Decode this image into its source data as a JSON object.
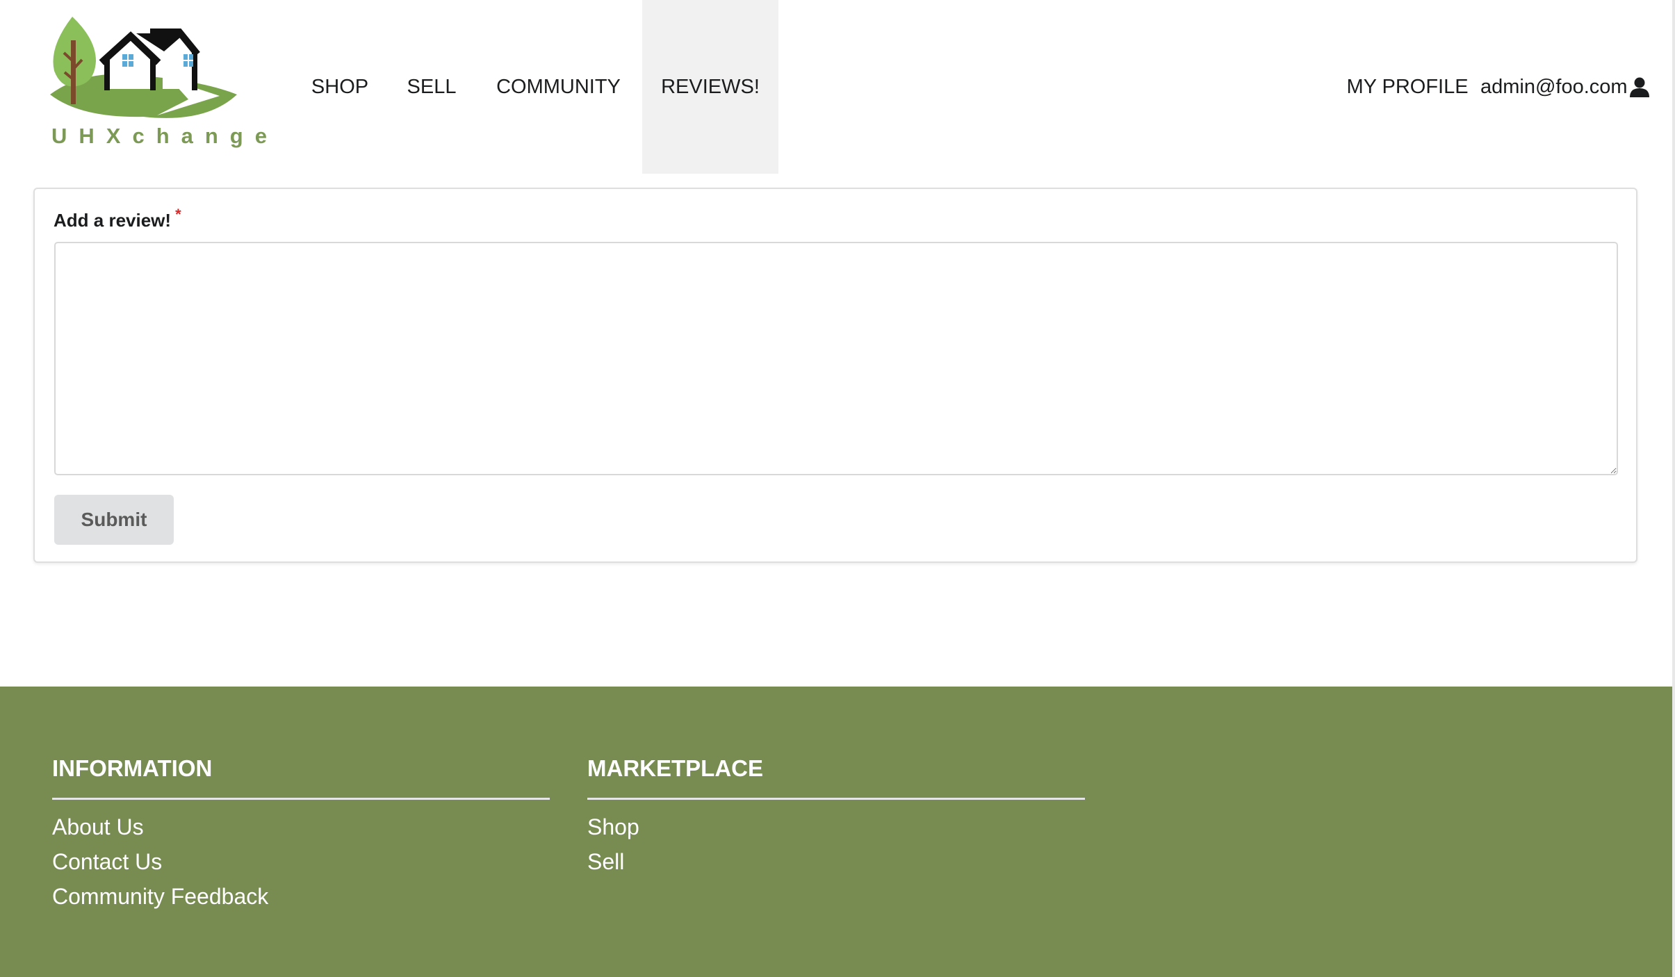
{
  "brand": {
    "logo_text": "UHXchange"
  },
  "nav": {
    "items": [
      {
        "label": "SHOP"
      },
      {
        "label": "SELL"
      },
      {
        "label": "COMMUNITY"
      },
      {
        "label": "REVIEWS!",
        "active": true
      }
    ],
    "profile_label": "MY PROFILE",
    "user_email": "admin@foo.com",
    "user_icon": "user-icon"
  },
  "review_form": {
    "label": "Add a review!",
    "required_marker": "*",
    "textarea_value": "",
    "submit_label": "Submit"
  },
  "footer": {
    "information": {
      "heading": "INFORMATION",
      "links": [
        "About Us",
        "Contact Us",
        "Community Feedback"
      ]
    },
    "marketplace": {
      "heading": "MARKETPLACE",
      "links": [
        "Shop",
        "Sell"
      ]
    }
  },
  "colors": {
    "footer_bg": "#788c52",
    "logo_green": "#7c9a56",
    "active_nav_bg": "#f1f1f1",
    "required_red": "#db2828",
    "submit_bg": "#e0e1e2"
  }
}
